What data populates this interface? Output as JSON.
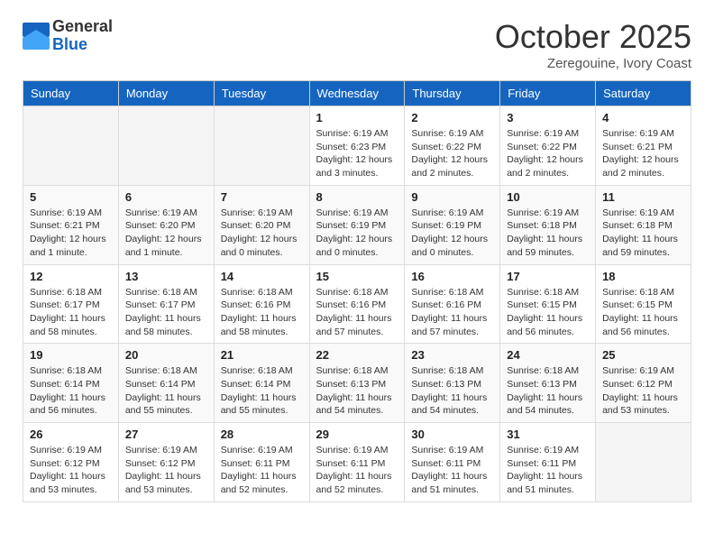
{
  "header": {
    "logo_general": "General",
    "logo_blue": "Blue",
    "month_title": "October 2025",
    "location": "Zeregouine, Ivory Coast"
  },
  "days_of_week": [
    "Sunday",
    "Monday",
    "Tuesday",
    "Wednesday",
    "Thursday",
    "Friday",
    "Saturday"
  ],
  "weeks": [
    [
      {
        "day": "",
        "info": ""
      },
      {
        "day": "",
        "info": ""
      },
      {
        "day": "",
        "info": ""
      },
      {
        "day": "1",
        "info": "Sunrise: 6:19 AM\nSunset: 6:23 PM\nDaylight: 12 hours and 3 minutes."
      },
      {
        "day": "2",
        "info": "Sunrise: 6:19 AM\nSunset: 6:22 PM\nDaylight: 12 hours and 2 minutes."
      },
      {
        "day": "3",
        "info": "Sunrise: 6:19 AM\nSunset: 6:22 PM\nDaylight: 12 hours and 2 minutes."
      },
      {
        "day": "4",
        "info": "Sunrise: 6:19 AM\nSunset: 6:21 PM\nDaylight: 12 hours and 2 minutes."
      }
    ],
    [
      {
        "day": "5",
        "info": "Sunrise: 6:19 AM\nSunset: 6:21 PM\nDaylight: 12 hours and 1 minute."
      },
      {
        "day": "6",
        "info": "Sunrise: 6:19 AM\nSunset: 6:20 PM\nDaylight: 12 hours and 1 minute."
      },
      {
        "day": "7",
        "info": "Sunrise: 6:19 AM\nSunset: 6:20 PM\nDaylight: 12 hours and 0 minutes."
      },
      {
        "day": "8",
        "info": "Sunrise: 6:19 AM\nSunset: 6:19 PM\nDaylight: 12 hours and 0 minutes."
      },
      {
        "day": "9",
        "info": "Sunrise: 6:19 AM\nSunset: 6:19 PM\nDaylight: 12 hours and 0 minutes."
      },
      {
        "day": "10",
        "info": "Sunrise: 6:19 AM\nSunset: 6:18 PM\nDaylight: 11 hours and 59 minutes."
      },
      {
        "day": "11",
        "info": "Sunrise: 6:19 AM\nSunset: 6:18 PM\nDaylight: 11 hours and 59 minutes."
      }
    ],
    [
      {
        "day": "12",
        "info": "Sunrise: 6:18 AM\nSunset: 6:17 PM\nDaylight: 11 hours and 58 minutes."
      },
      {
        "day": "13",
        "info": "Sunrise: 6:18 AM\nSunset: 6:17 PM\nDaylight: 11 hours and 58 minutes."
      },
      {
        "day": "14",
        "info": "Sunrise: 6:18 AM\nSunset: 6:16 PM\nDaylight: 11 hours and 58 minutes."
      },
      {
        "day": "15",
        "info": "Sunrise: 6:18 AM\nSunset: 6:16 PM\nDaylight: 11 hours and 57 minutes."
      },
      {
        "day": "16",
        "info": "Sunrise: 6:18 AM\nSunset: 6:16 PM\nDaylight: 11 hours and 57 minutes."
      },
      {
        "day": "17",
        "info": "Sunrise: 6:18 AM\nSunset: 6:15 PM\nDaylight: 11 hours and 56 minutes."
      },
      {
        "day": "18",
        "info": "Sunrise: 6:18 AM\nSunset: 6:15 PM\nDaylight: 11 hours and 56 minutes."
      }
    ],
    [
      {
        "day": "19",
        "info": "Sunrise: 6:18 AM\nSunset: 6:14 PM\nDaylight: 11 hours and 56 minutes."
      },
      {
        "day": "20",
        "info": "Sunrise: 6:18 AM\nSunset: 6:14 PM\nDaylight: 11 hours and 55 minutes."
      },
      {
        "day": "21",
        "info": "Sunrise: 6:18 AM\nSunset: 6:14 PM\nDaylight: 11 hours and 55 minutes."
      },
      {
        "day": "22",
        "info": "Sunrise: 6:18 AM\nSunset: 6:13 PM\nDaylight: 11 hours and 54 minutes."
      },
      {
        "day": "23",
        "info": "Sunrise: 6:18 AM\nSunset: 6:13 PM\nDaylight: 11 hours and 54 minutes."
      },
      {
        "day": "24",
        "info": "Sunrise: 6:18 AM\nSunset: 6:13 PM\nDaylight: 11 hours and 54 minutes."
      },
      {
        "day": "25",
        "info": "Sunrise: 6:19 AM\nSunset: 6:12 PM\nDaylight: 11 hours and 53 minutes."
      }
    ],
    [
      {
        "day": "26",
        "info": "Sunrise: 6:19 AM\nSunset: 6:12 PM\nDaylight: 11 hours and 53 minutes."
      },
      {
        "day": "27",
        "info": "Sunrise: 6:19 AM\nSunset: 6:12 PM\nDaylight: 11 hours and 53 minutes."
      },
      {
        "day": "28",
        "info": "Sunrise: 6:19 AM\nSunset: 6:11 PM\nDaylight: 11 hours and 52 minutes."
      },
      {
        "day": "29",
        "info": "Sunrise: 6:19 AM\nSunset: 6:11 PM\nDaylight: 11 hours and 52 minutes."
      },
      {
        "day": "30",
        "info": "Sunrise: 6:19 AM\nSunset: 6:11 PM\nDaylight: 11 hours and 51 minutes."
      },
      {
        "day": "31",
        "info": "Sunrise: 6:19 AM\nSunset: 6:11 PM\nDaylight: 11 hours and 51 minutes."
      },
      {
        "day": "",
        "info": ""
      }
    ]
  ]
}
